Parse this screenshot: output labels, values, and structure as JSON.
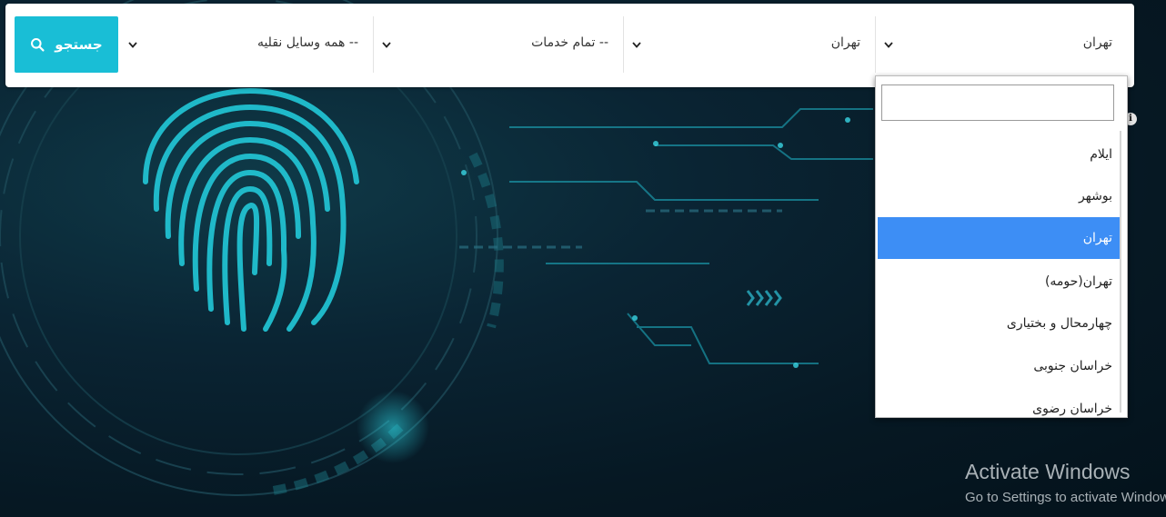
{
  "search_bar": {
    "search_button_label": "جستجو",
    "vehicle_select_value": "-- همه وسایل نقلیه",
    "service_select_value": "-- تمام خدمات",
    "city_select_value": "تهران",
    "province_select_value": "تهران"
  },
  "province_dropdown": {
    "search_value": "",
    "options": [
      {
        "label": "ایلام"
      },
      {
        "label": "بوشهر"
      },
      {
        "label": "تهران",
        "selected": true
      },
      {
        "label": "تهران(حومه)"
      },
      {
        "label": "چهارمحال و بختیاری"
      },
      {
        "label": "خراسان جنوبی"
      },
      {
        "label": "خراسان رضوی"
      }
    ]
  },
  "info_icon_glyph": "i",
  "watermark": {
    "title": "Activate Windows",
    "subtitle": "Go to Settings to activate Windows."
  },
  "colors": {
    "accent": "#19bed6",
    "selected_option": "#3d8ef5",
    "background": "#06202c",
    "circuit": "#1fb6c9"
  },
  "icons": {
    "search_button": "search-icon",
    "select_arrow": "chevron-down-icon",
    "background_art": "fingerprint-icon"
  }
}
